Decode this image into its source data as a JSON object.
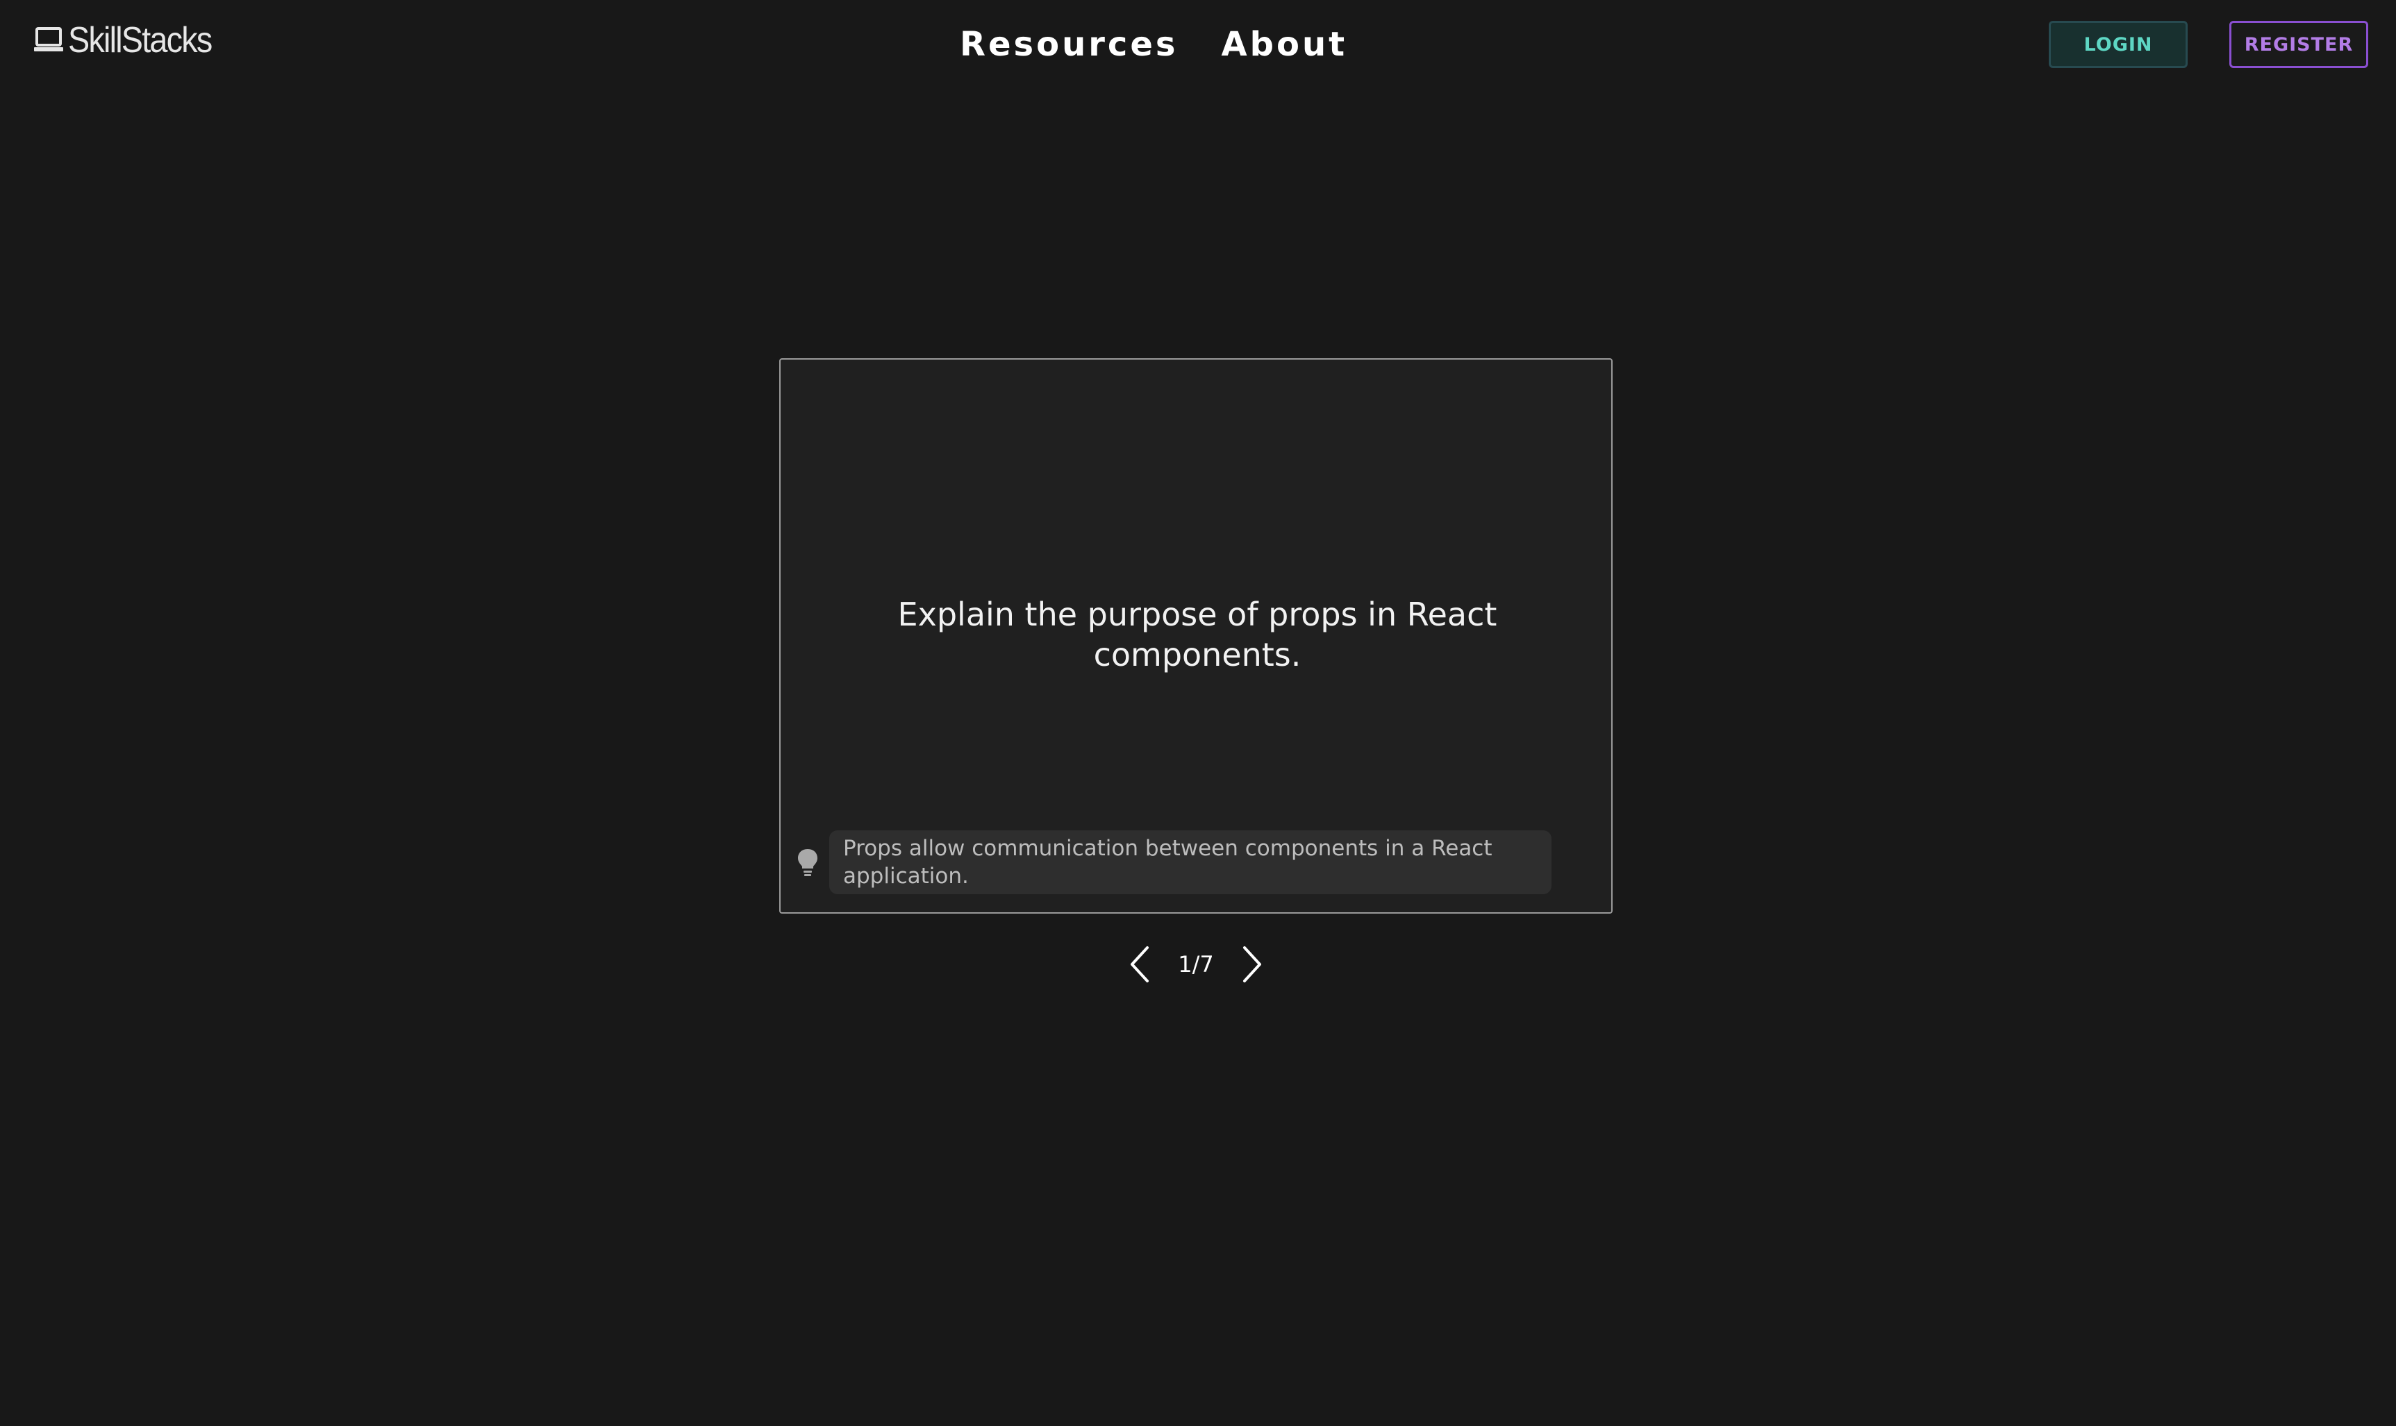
{
  "brand": {
    "name": "SkillStacks",
    "icon": "laptop-icon"
  },
  "nav": {
    "resources": "Resources",
    "about": "About"
  },
  "auth": {
    "login": "LOGIN",
    "register": "REGISTER"
  },
  "card": {
    "question": "Explain the purpose of props in React components.",
    "hint_icon": "lightbulb-icon",
    "hint": "Props allow communication between components in a React application."
  },
  "pager": {
    "prev_icon": "chevron-left-icon",
    "next_icon": "chevron-right-icon",
    "counter": "1/7"
  },
  "colors": {
    "background": "#181818",
    "card": "#202020",
    "login_accent": "#5ed7c4",
    "register_accent": "#8a4fd1"
  }
}
